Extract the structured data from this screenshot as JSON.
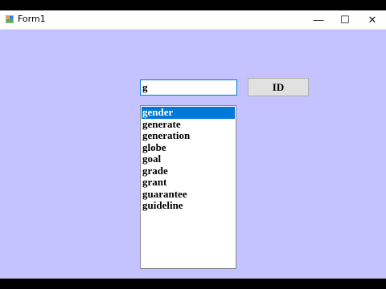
{
  "window": {
    "title": "Form1",
    "controls": {
      "minimize": "—",
      "maximize": "☐",
      "close": "✕"
    }
  },
  "search": {
    "value": "g"
  },
  "id_button": {
    "label": "ID"
  },
  "listbox": {
    "items": [
      "gender",
      "generate",
      "generation",
      "globe",
      "goal",
      "grade",
      "grant",
      "guarantee",
      "guideline"
    ],
    "selected_index": 0
  },
  "colors": {
    "form_background": "#c4c3ff",
    "selection": "#0078d7",
    "focus_border": "#0078d7"
  }
}
